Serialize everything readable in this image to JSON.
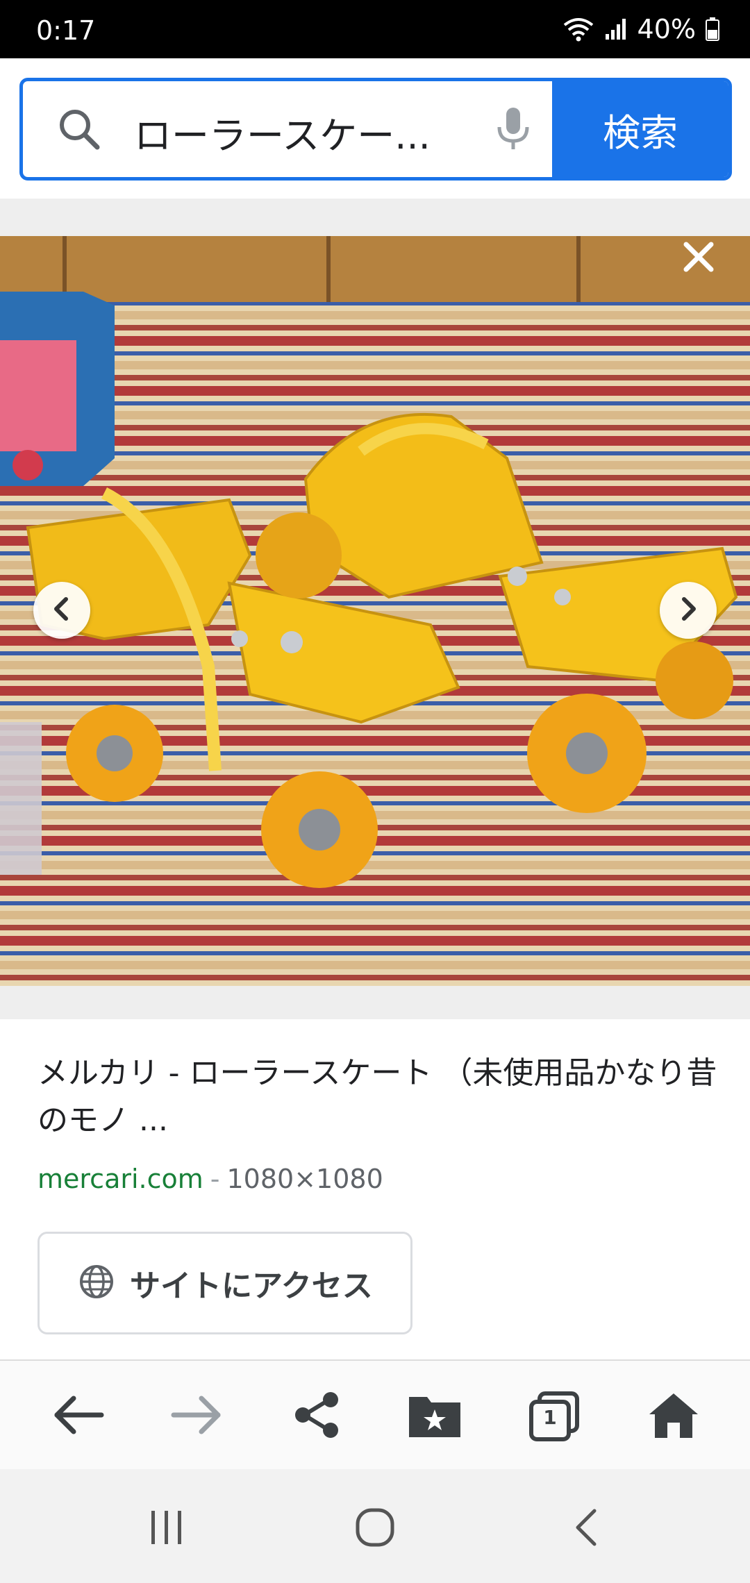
{
  "status_bar": {
    "time": "0:17",
    "battery": "40%"
  },
  "search": {
    "query": "ローラースケー...",
    "button_label": "検索"
  },
  "result": {
    "title": "メルカリ - ローラースケート （未使用品かなり昔のモノ ...",
    "site": "mercari.com",
    "separator": "-",
    "dimensions": "1080×1080",
    "visit_label": "サイトにアクセス"
  },
  "toolbar": {
    "tab_count": "1"
  },
  "colors": {
    "accent": "#1a73e8",
    "site_green": "#188038",
    "skate_yellow": "#f5c21b"
  },
  "icons": [
    "search-icon",
    "mic-icon",
    "close-icon",
    "chevron-left-icon",
    "chevron-right-icon",
    "globe-icon",
    "back-arrow-icon",
    "forward-arrow-icon",
    "share-icon",
    "bookmark-folder-icon",
    "tabs-icon",
    "home-icon",
    "recents-icon",
    "home-circle-icon",
    "android-back-icon",
    "wifi-icon",
    "signal-icon",
    "battery-icon"
  ]
}
